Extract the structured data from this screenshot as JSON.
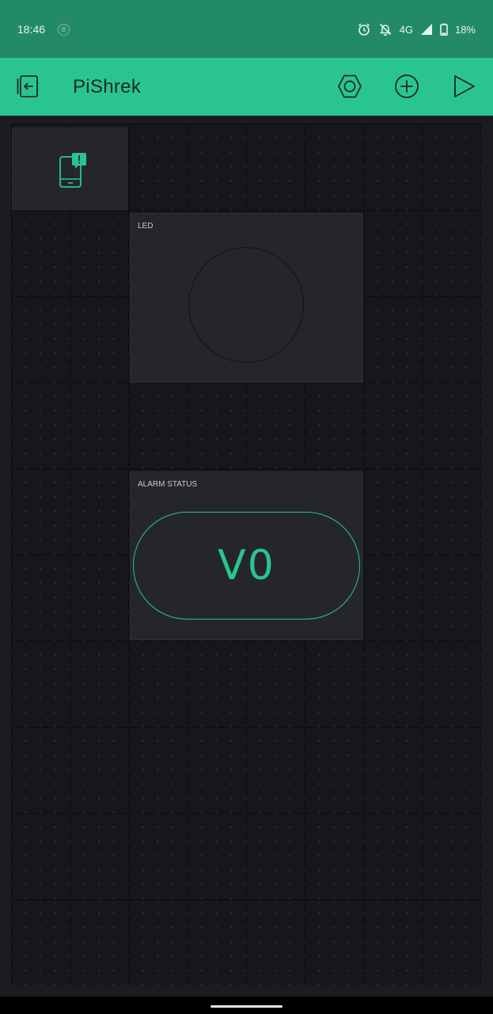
{
  "status_bar": {
    "time": "18:46",
    "notification_badge": "B",
    "network": "4G",
    "battery": "18%",
    "icons": [
      "alarm-icon",
      "notifications-off-icon",
      "signal-icon",
      "battery-icon"
    ]
  },
  "app_bar": {
    "title": "PiShrek",
    "icons": [
      "exit-project-icon",
      "settings-hex-icon",
      "add-widget-icon",
      "play-icon"
    ]
  },
  "widgets": {
    "notification": {
      "icon": "phone-notification-icon"
    },
    "led": {
      "label": "LED"
    },
    "alarm": {
      "label": "ALARM STATUS",
      "value": "V0"
    }
  },
  "colors": {
    "status_bar": "#238a67",
    "app_bar": "#2ac58f",
    "accent": "#2ac58f",
    "background": "#1b1c21",
    "widget": "#25262b"
  }
}
